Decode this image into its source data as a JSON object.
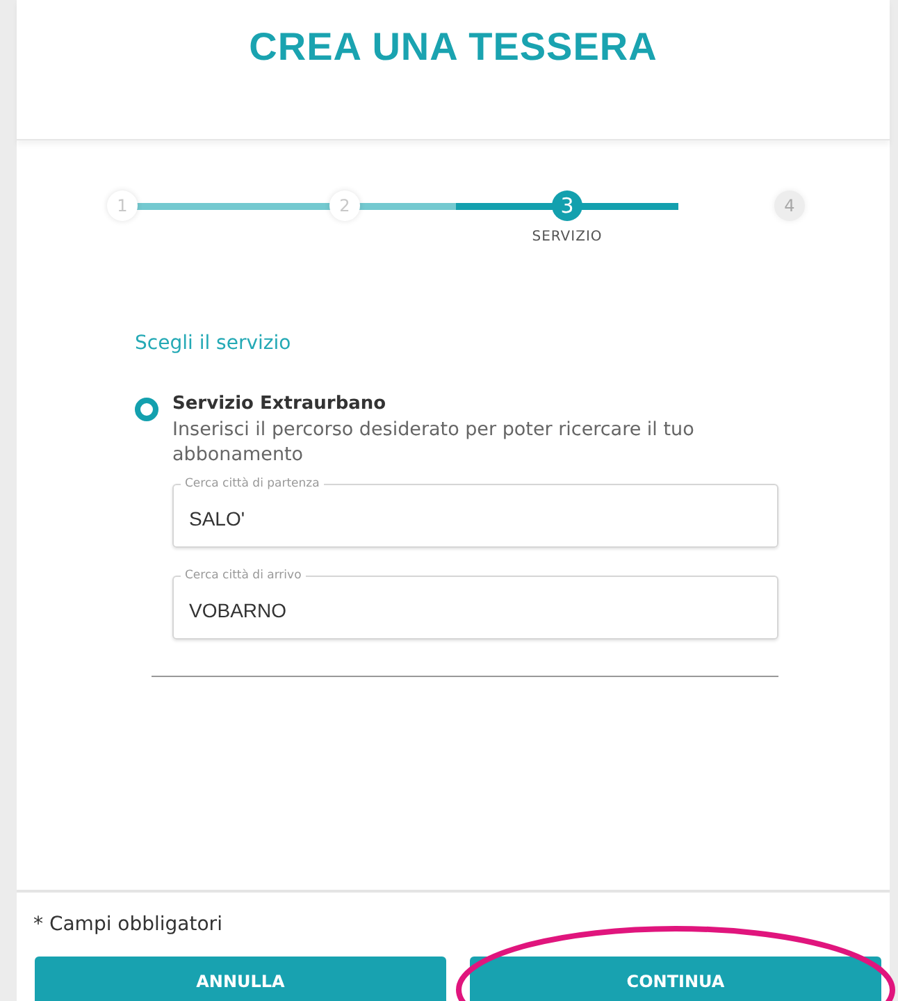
{
  "title": "CREA UNA TESSERA",
  "steps": [
    {
      "number": "1",
      "done": true,
      "selected": false
    },
    {
      "number": "2",
      "done": true,
      "selected": false
    },
    {
      "number": "3",
      "done": false,
      "selected": true,
      "label": "SERVIZIO"
    },
    {
      "number": "4",
      "done": false,
      "selected": false
    }
  ],
  "section_title": "Scegli il servizio",
  "service": {
    "label": "Servizio Extraurbano",
    "selected": true,
    "description": "Inserisci il percorso desiderato per poter ricercare il tuo abbonamento"
  },
  "fields": [
    {
      "label": "Cerca città di partenza",
      "value": "SALO'"
    },
    {
      "label": "Cerca città di arrivo",
      "value": "VOBARNO"
    }
  ],
  "required_note": "* Campi obbligatori",
  "buttons": [
    {
      "label": "ANNULLA",
      "highlighted": false
    },
    {
      "label": "CONTINUA",
      "highlighted": true
    }
  ]
}
